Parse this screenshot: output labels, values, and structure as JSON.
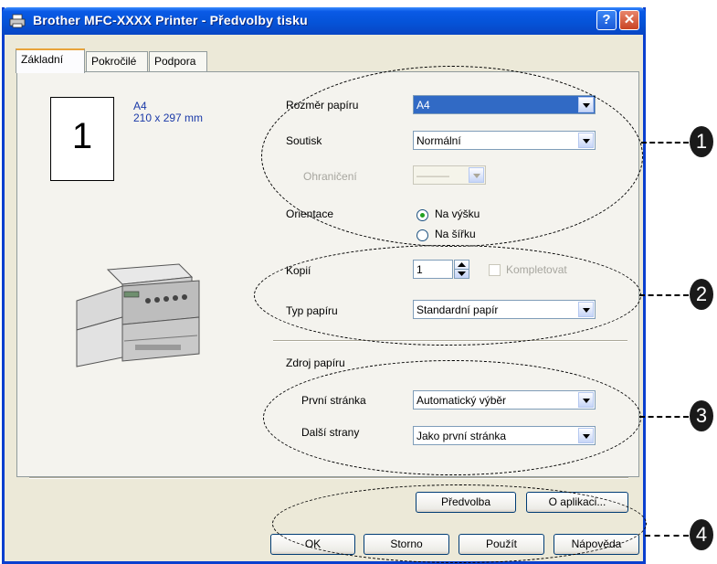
{
  "window": {
    "title": "Brother MFC-XXXX  Printer - Předvolby tisku",
    "help_label": "?",
    "close_label": "✕"
  },
  "tabs": [
    {
      "label": "Základní"
    },
    {
      "label": "Pokročilé"
    },
    {
      "label": "Podpora"
    }
  ],
  "preview": {
    "number": "1",
    "size_name": "A4",
    "size_dims": "210 x 297 mm"
  },
  "paper": {
    "size_label": "Rozměr papíru",
    "size_value": "A4",
    "multipage_label": "Soutisk",
    "multipage_value": "Normální",
    "border_label": "Ohraničení",
    "border_value": "———",
    "orientation_label": "Orientace",
    "portrait_label": "Na výšku",
    "landscape_label": "Na šířku"
  },
  "copies": {
    "label": "Kopií",
    "value": "1",
    "collate_label": "Kompletovat"
  },
  "media": {
    "label": "Typ papíru",
    "value": "Standardní papír"
  },
  "source": {
    "section_label": "Zdroj papíru",
    "first_label": "První stránka",
    "first_value": "Automatický výběr",
    "other_label": "Další strany",
    "other_value": "Jako první stránka"
  },
  "buttons": {
    "defaults": "Předvolba",
    "about": "O aplikaci...",
    "ok": "OK",
    "cancel": "Storno",
    "apply": "Použít",
    "help": "Nápověda"
  },
  "callouts": [
    "1",
    "2",
    "3",
    "4"
  ]
}
